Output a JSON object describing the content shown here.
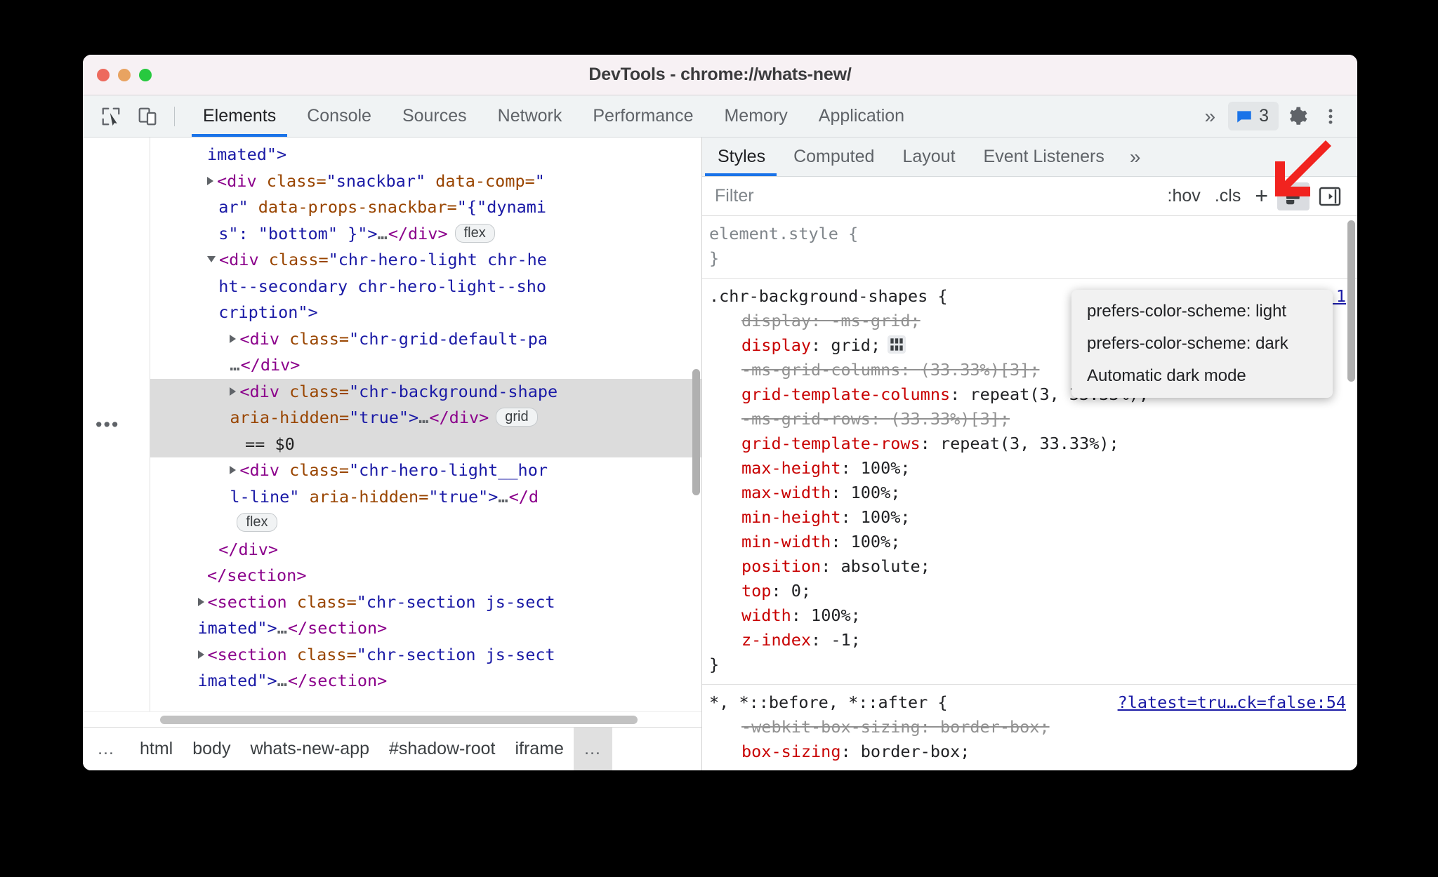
{
  "window": {
    "title": "DevTools - chrome://whats-new/",
    "traffic_lights": [
      "close",
      "minimize",
      "zoom"
    ]
  },
  "toolbar": {
    "inspect_icon": "inspect-element-icon",
    "device_icon": "device-toolbar-icon",
    "tabs": [
      {
        "label": "Elements",
        "active": true
      },
      {
        "label": "Console",
        "active": false
      },
      {
        "label": "Sources",
        "active": false
      },
      {
        "label": "Network",
        "active": false
      },
      {
        "label": "Performance",
        "active": false
      },
      {
        "label": "Memory",
        "active": false
      },
      {
        "label": "Application",
        "active": false
      }
    ],
    "more_tabs": "»",
    "message_count": "3",
    "settings_icon": "gear-icon",
    "menu_icon": "kebab-menu-icon"
  },
  "dom_tree": {
    "gutter_dots": "•••",
    "lines": [
      {
        "indent": 3,
        "parts": [
          {
            "t": "av",
            "s": "imated\">"
          }
        ]
      },
      {
        "indent": 3,
        "arrow": "closed",
        "parts": [
          {
            "t": "tw",
            "s": "<div "
          },
          {
            "t": "at",
            "s": "class="
          },
          {
            "t": "av",
            "s": "\"snackbar\" "
          },
          {
            "t": "at",
            "s": "data-comp="
          },
          {
            "t": "av",
            "s": "\""
          }
        ]
      },
      {
        "indent": 3.6,
        "parts": [
          {
            "t": "av",
            "s": "ar\" "
          },
          {
            "t": "at",
            "s": "data-props-snackbar="
          },
          {
            "t": "av",
            "s": "\"{\"dynami"
          }
        ]
      },
      {
        "indent": 3.6,
        "parts": [
          {
            "t": "av",
            "s": "s\": \"bottom\" }\">"
          },
          {
            "t": "ell",
            "s": "…"
          },
          {
            "t": "tw",
            "s": "</div>"
          },
          {
            "t": "badge",
            "s": "flex"
          }
        ]
      },
      {
        "indent": 3,
        "arrow": "open",
        "parts": [
          {
            "t": "tw",
            "s": "<div "
          },
          {
            "t": "at",
            "s": "class="
          },
          {
            "t": "av",
            "s": "\"chr-hero-light chr-he"
          }
        ]
      },
      {
        "indent": 3.6,
        "parts": [
          {
            "t": "av",
            "s": "ht--secondary chr-hero-light--sho"
          }
        ]
      },
      {
        "indent": 3.6,
        "parts": [
          {
            "t": "av",
            "s": "cription\">"
          }
        ]
      },
      {
        "indent": 4.2,
        "arrow": "closed",
        "parts": [
          {
            "t": "tw",
            "s": "<div "
          },
          {
            "t": "at",
            "s": "class="
          },
          {
            "t": "av",
            "s": "\"chr-grid-default-pa"
          }
        ]
      },
      {
        "indent": 4.2,
        "parts": [
          {
            "t": "ell",
            "s": "…"
          },
          {
            "t": "tw",
            "s": "</div>"
          }
        ]
      },
      {
        "indent": 4.2,
        "selected": true,
        "arrow": "closed",
        "parts": [
          {
            "t": "tw",
            "s": "<div "
          },
          {
            "t": "at",
            "s": "class="
          },
          {
            "t": "av",
            "s": "\"chr-background-shape"
          }
        ]
      },
      {
        "indent": 4.2,
        "selected": true,
        "parts": [
          {
            "t": "at",
            "s": "aria-hidden="
          },
          {
            "t": "av",
            "s": "\"true\">"
          },
          {
            "t": "ell",
            "s": "…"
          },
          {
            "t": "tw",
            "s": "</div>"
          },
          {
            "t": "badge",
            "s": "grid"
          }
        ]
      },
      {
        "indent": 5.0,
        "selected": true,
        "parts": [
          {
            "t": "txt",
            "s": "== $0"
          }
        ]
      },
      {
        "indent": 4.2,
        "arrow": "closed",
        "parts": [
          {
            "t": "tw",
            "s": "<div "
          },
          {
            "t": "at",
            "s": "class="
          },
          {
            "t": "av",
            "s": "\"chr-hero-light__hor"
          }
        ]
      },
      {
        "indent": 4.2,
        "parts": [
          {
            "t": "av",
            "s": "l-line\" "
          },
          {
            "t": "at",
            "s": "aria-hidden="
          },
          {
            "t": "av",
            "s": "\"true\">"
          },
          {
            "t": "ell",
            "s": "…"
          },
          {
            "t": "tw",
            "s": "</d"
          }
        ]
      },
      {
        "indent": 4.2,
        "parts": [
          {
            "t": "badge",
            "s": "flex"
          }
        ]
      },
      {
        "indent": 3.6,
        "parts": [
          {
            "t": "tw",
            "s": "</div>"
          }
        ]
      },
      {
        "indent": 3.0,
        "parts": [
          {
            "t": "tw",
            "s": "</section>"
          }
        ]
      },
      {
        "indent": 2.5,
        "arrow": "closed",
        "parts": [
          {
            "t": "tw",
            "s": "<section "
          },
          {
            "t": "at",
            "s": "class="
          },
          {
            "t": "av",
            "s": "\"chr-section js-sect"
          }
        ]
      },
      {
        "indent": 2.5,
        "parts": [
          {
            "t": "av",
            "s": "imated\">"
          },
          {
            "t": "ell",
            "s": "…"
          },
          {
            "t": "tw",
            "s": "</section>"
          }
        ]
      },
      {
        "indent": 2.5,
        "arrow": "closed",
        "parts": [
          {
            "t": "tw",
            "s": "<section "
          },
          {
            "t": "at",
            "s": "class="
          },
          {
            "t": "av",
            "s": "\"chr-section js-sect"
          }
        ]
      },
      {
        "indent": 2.5,
        "parts": [
          {
            "t": "av",
            "s": "imated\">"
          },
          {
            "t": "ell",
            "s": "…"
          },
          {
            "t": "tw",
            "s": "</section>"
          }
        ]
      }
    ]
  },
  "breadcrumb": {
    "leading_dots": "…",
    "items": [
      "html",
      "body",
      "whats-new-app",
      "#shadow-root",
      "iframe"
    ],
    "trailing_dots": "…"
  },
  "styles_panel": {
    "tabs": [
      {
        "label": "Styles",
        "active": true
      },
      {
        "label": "Computed",
        "active": false
      },
      {
        "label": "Layout",
        "active": false
      },
      {
        "label": "Event Listeners",
        "active": false
      }
    ],
    "more_tabs": "»",
    "filter_placeholder": "Filter",
    "filter_value": "",
    "hov_label": ":hov",
    "cls_label": ".cls",
    "plus_label": "+",
    "color_scheme_icon": "paint-brush-icon",
    "sidebar_toggle_icon": "show-computed-sidebar-icon",
    "rules": [
      {
        "selector": "element.style",
        "selector_style": "gray",
        "origin": "",
        "declarations": []
      },
      {
        "selector": ".chr-background-shapes",
        "selector_style": "dark",
        "origin": "n.css:1",
        "declarations": [
          {
            "prop": "display",
            "value": "-ms-grid",
            "struck": true
          },
          {
            "prop": "display",
            "value": "grid",
            "struck": false,
            "badge": "grid-badge"
          },
          {
            "prop": "-ms-grid-columns",
            "value": "(33.33%)[3]",
            "struck": true
          },
          {
            "prop": "grid-template-columns",
            "value": "repeat(3, 33.33%)",
            "struck": false
          },
          {
            "prop": "-ms-grid-rows",
            "value": "(33.33%)[3]",
            "struck": true
          },
          {
            "prop": "grid-template-rows",
            "value": "repeat(3, 33.33%)",
            "struck": false
          },
          {
            "prop": "max-height",
            "value": "100%",
            "struck": false
          },
          {
            "prop": "max-width",
            "value": "100%",
            "struck": false
          },
          {
            "prop": "min-height",
            "value": "100%",
            "struck": false
          },
          {
            "prop": "min-width",
            "value": "100%",
            "struck": false
          },
          {
            "prop": "position",
            "value": "absolute",
            "struck": false
          },
          {
            "prop": "top",
            "value": "0",
            "struck": false
          },
          {
            "prop": "width",
            "value": "100%",
            "struck": false
          },
          {
            "prop": "z-index",
            "value": "-1",
            "struck": false
          }
        ]
      },
      {
        "selector": "*, *::before, *::after",
        "selector_style": "dark",
        "origin": "?latest=tru…ck=false:54",
        "declarations": [
          {
            "prop": "-webkit-box-sizing",
            "value": "border-box",
            "struck": true
          },
          {
            "prop": "box-sizing",
            "value": "border-box",
            "struck": false
          }
        ]
      }
    ]
  },
  "color_scheme_menu": {
    "items": [
      "prefers-color-scheme: light",
      "prefers-color-scheme: dark",
      "Automatic dark mode"
    ]
  },
  "annotation": {
    "arrow_color": "#f1231f",
    "arrow_direction": "down-left"
  }
}
